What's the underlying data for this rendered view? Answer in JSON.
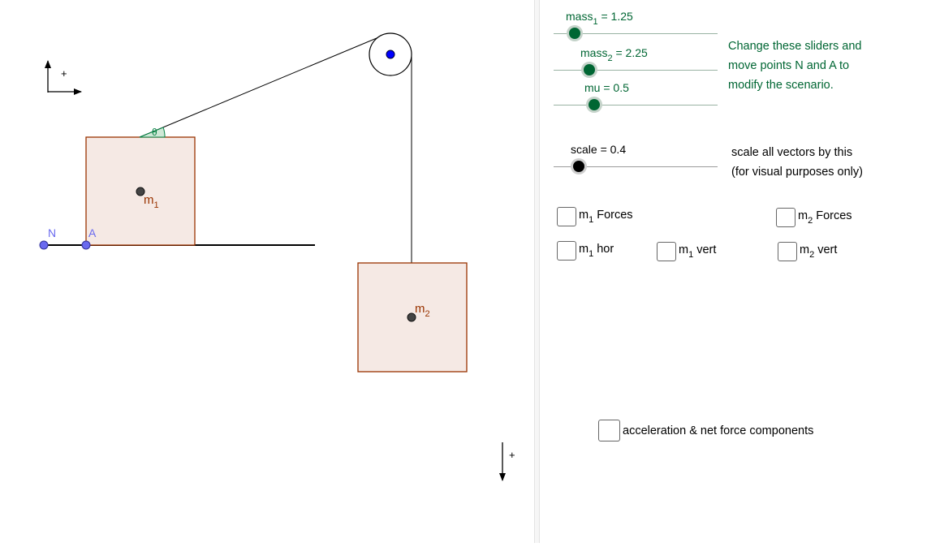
{
  "graphics": {
    "points": {
      "n_label": "N",
      "a_label": "A"
    },
    "angle_label": "θ",
    "block1": {
      "name": "m",
      "sub": "1"
    },
    "block2": {
      "name": "m",
      "sub": "2"
    },
    "axis_top_plus": "+",
    "axis_bottom_plus": "+"
  },
  "sliders": {
    "mass1": {
      "name": "mass",
      "sub": "1",
      "value_text": "= 1.25",
      "fraction": 0.06
    },
    "mass2": {
      "name": "mass",
      "sub": "2",
      "value_text": "= 2.25",
      "fraction": 0.23
    },
    "mu": {
      "label": "mu = 0.5",
      "fraction": 0.25
    },
    "scale": {
      "label": "scale = 0.4",
      "fraction": 0.16
    }
  },
  "notes": {
    "change_line1": "Change these sliders and",
    "change_line2": "move points N and A to",
    "change_line3": "modify the scenario.",
    "scale_line1": "scale all vectors by this",
    "scale_line2": "(for visual purposes only)"
  },
  "checkboxes": {
    "m1_forces": {
      "prefix": "m",
      "sub": "1",
      "suffix": " Forces",
      "checked": false
    },
    "m2_forces": {
      "prefix": "m",
      "sub": "2",
      "suffix": " Forces",
      "checked": false
    },
    "m1_hor": {
      "prefix": "m",
      "sub": "1",
      "suffix": " hor",
      "checked": false
    },
    "m1_vert": {
      "prefix": "m",
      "sub": "1",
      "suffix": " vert",
      "checked": false
    },
    "m2_vert": {
      "prefix": "m",
      "sub": "2",
      "suffix": " vert",
      "checked": false
    },
    "accel": {
      "label": "acceleration & net force components",
      "checked": false
    }
  },
  "colors": {
    "slider_green": "#006633",
    "block_fill": "#f5e9e4",
    "block_stroke": "#993300",
    "point_blue": "#6a6aef",
    "pulley_center": "#0000ff",
    "angle_green": "#008040"
  }
}
